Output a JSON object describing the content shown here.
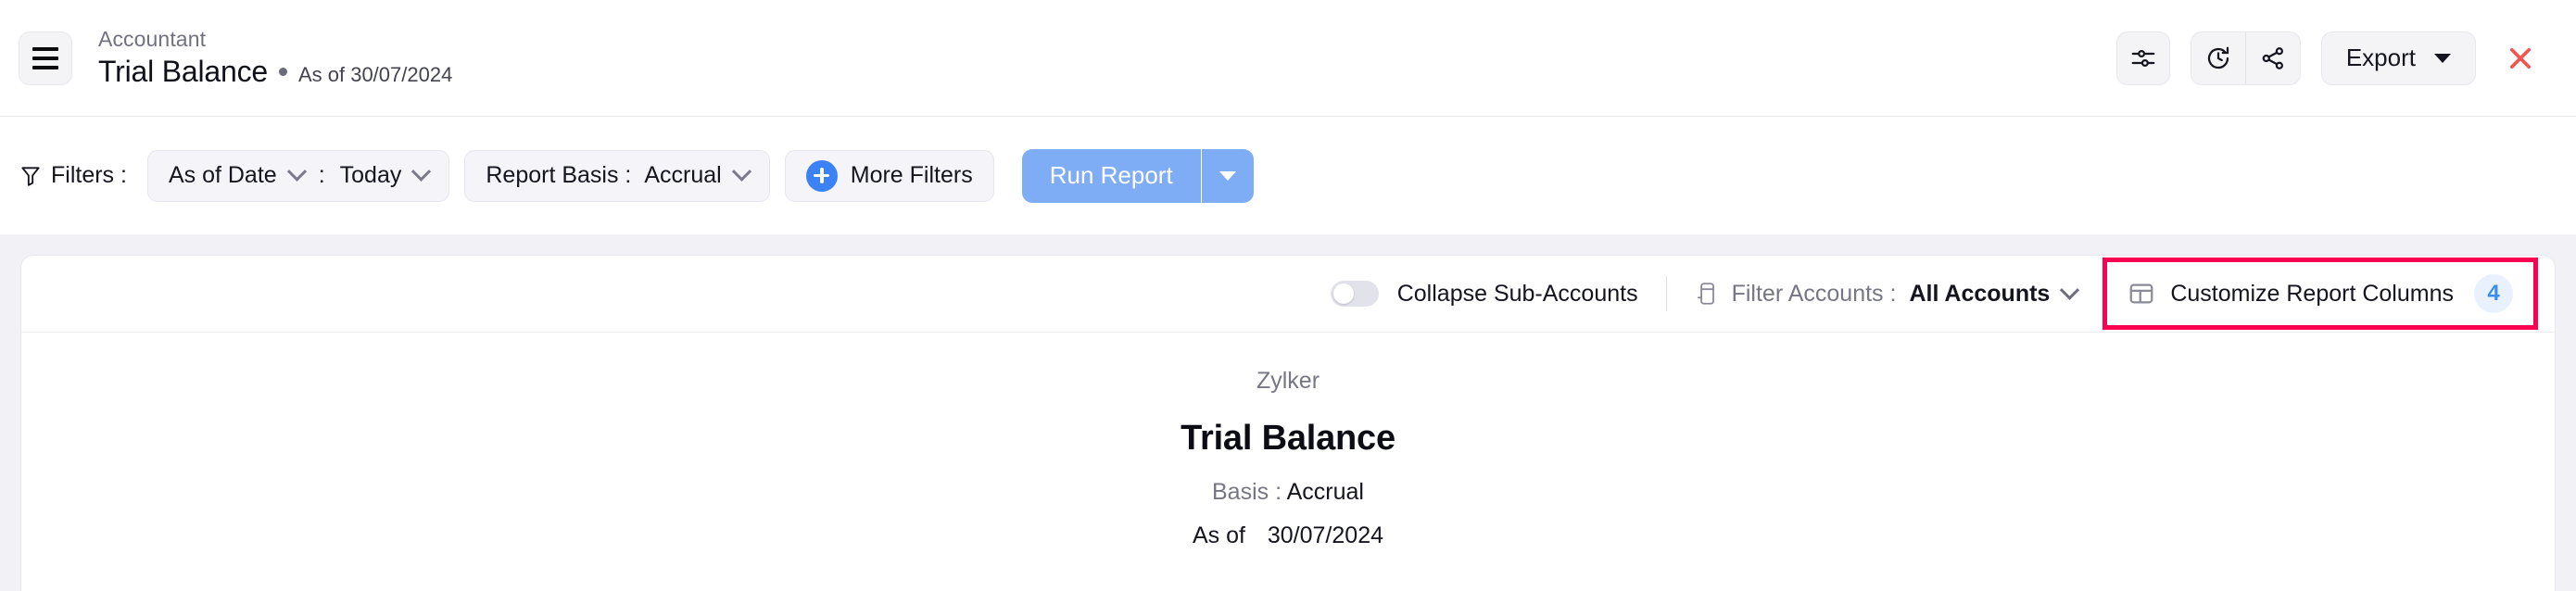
{
  "header": {
    "menu_icon": "hamburger-menu-icon",
    "breadcrumb": "Accountant",
    "title": "Trial Balance",
    "subtitle": "As of 30/07/2024",
    "actions": {
      "preferences_icon": "sliders-icon",
      "schedule_icon": "clock-refresh-icon",
      "share_icon": "share-nodes-icon",
      "export_label": "Export",
      "close_icon": "close-x-icon"
    }
  },
  "filters": {
    "filter_icon": "funnel-icon",
    "label": "Filters :",
    "date_filter": {
      "field_label": "As of Date",
      "separator": ":",
      "value": "Today"
    },
    "report_basis": {
      "label": "Report Basis :",
      "value": "Accrual"
    },
    "more_filters_label": "More Filters",
    "more_filters_icon": "plus-circle-icon",
    "run_report_label": "Run Report"
  },
  "card_toolbar": {
    "collapse_toggle": {
      "label": "Collapse Sub-Accounts",
      "enabled": false
    },
    "filter_accounts": {
      "icon": "accounts-column-icon",
      "label": "Filter Accounts :",
      "value": "All Accounts"
    },
    "customize_columns": {
      "icon": "table-columns-icon",
      "label": "Customize Report Columns",
      "count": "4",
      "highlighted": true,
      "highlight_color": "#fa0050"
    }
  },
  "report": {
    "organization": "Zylker",
    "title": "Trial Balance",
    "basis_label": "Basis",
    "basis_separator": ":",
    "basis_value": "Accrual",
    "asof_label": "As of",
    "asof_value": "30/07/2024"
  },
  "colors": {
    "accent_blue": "#7fadf5",
    "badge_blue": "#3b8ef0",
    "highlight_pink": "#fa0050",
    "close_red": "#f25650",
    "page_bg": "#f1f1f6"
  }
}
